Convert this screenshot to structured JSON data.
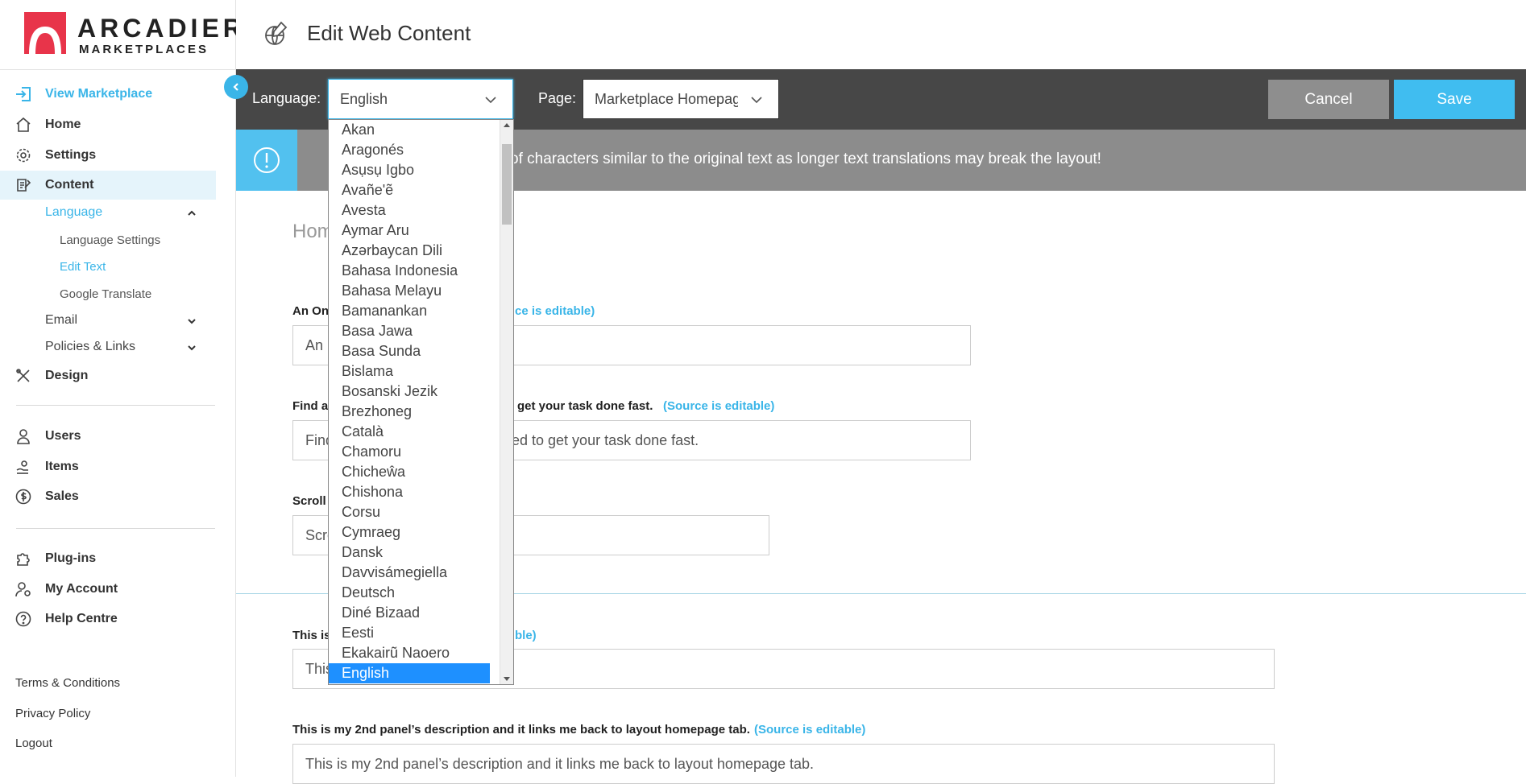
{
  "brand": {
    "name": "ARCADIER",
    "tagline": "MARKETPLACES"
  },
  "header": {
    "title": "Edit Web Content"
  },
  "sidebar": {
    "nav": [
      {
        "label": "View Marketplace"
      },
      {
        "label": "Home"
      },
      {
        "label": "Settings"
      },
      {
        "label": "Content"
      },
      {
        "label": "Design"
      },
      {
        "label": "Users"
      },
      {
        "label": "Items"
      },
      {
        "label": "Sales"
      },
      {
        "label": "Plug-ins"
      },
      {
        "label": "My Account"
      },
      {
        "label": "Help Centre"
      }
    ],
    "content_sub": {
      "language": "Language",
      "language_settings": "Language Settings",
      "edit_text": "Edit Text",
      "google_translate": "Google Translate",
      "email": "Email",
      "policies_links": "Policies & Links"
    },
    "footer": {
      "terms": "Terms & Conditions",
      "privacy": "Privacy Policy",
      "logout": "Logout"
    }
  },
  "toolbar": {
    "language_label": "Language:",
    "language_value": "English",
    "page_label": "Page:",
    "page_value": "Marketplace Homepage",
    "cancel_label": "Cancel",
    "save_label": "Save"
  },
  "info": {
    "text": "of characters similar to the original text as longer text translations may break the layout!"
  },
  "main": {
    "section_heading": "Hom",
    "fields": [
      {
        "label": "An On",
        "editable": "ce is editable)",
        "value": "An"
      },
      {
        "label": "Find a",
        "label_tail": "get your task done fast.",
        "editable": "(Source is editable)",
        "value_head": "Find",
        "value_tail": "ed to get your task done fast."
      },
      {
        "label": "Scroll",
        "value": "Scro"
      },
      {
        "label": "This is",
        "editable": "ble)",
        "value": "This"
      },
      {
        "label": "This is my 2nd panel’s description and it links me back to layout homepage tab.",
        "editable": "(Source is editable)",
        "value": "This is my 2nd panel’s description and it links me back to layout homepage tab."
      }
    ]
  },
  "dropdown": {
    "options": [
      "Akan",
      "Aragonés",
      "Asụsụ Igbo",
      "Avañe'ẽ",
      "Avesta",
      "Aymar Aru",
      "Azərbaycan Dili",
      "Bahasa Indonesia",
      "Bahasa Melayu",
      "Bamanankan",
      "Basa Jawa",
      "Basa Sunda",
      "Bislama",
      "Bosanski Jezik",
      "Brezhoneg",
      "Català",
      "Chamoru",
      "Chicheŵa",
      "Chishona",
      "Corsu",
      "Cymraeg",
      "Dansk",
      "Davvisámegiella",
      "Deutsch",
      "Diné Bizaad",
      "Eesti",
      "Ekakairũ Naoero",
      "English"
    ],
    "selected": "English"
  },
  "colors": {
    "accent": "#3ab5e8",
    "toolbar": "#474747",
    "info_bar": "#8c8c8c",
    "save": "#40bdf0",
    "cancel": "#8e8e8e"
  }
}
